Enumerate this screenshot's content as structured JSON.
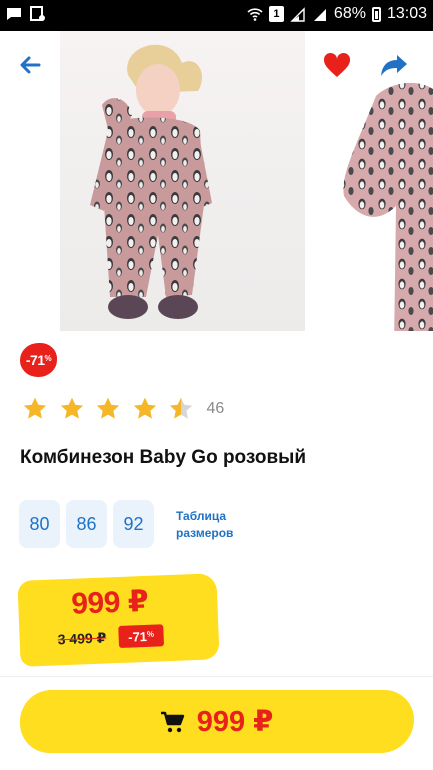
{
  "status_bar": {
    "battery": "68%",
    "time": "13:03",
    "sim_label": "1"
  },
  "product": {
    "discount_badge": "-71",
    "discount_suffix": "%",
    "rating": 4.5,
    "review_count": "46",
    "title": "Комбинезон Baby Go розовый",
    "sizes": [
      "80",
      "86",
      "92"
    ],
    "size_table_link": "Таблица размеров",
    "price": "999 ₽",
    "old_price": "3 499 ₽",
    "old_price_discount": "-71",
    "old_price_discount_suffix": "%",
    "buy_button_label": "999 ₽"
  },
  "colors": {
    "accent_red": "#e8211b",
    "price_yellow": "#ffdd1f",
    "link_blue": "#1f72c4",
    "star_yellow": "#f5b727"
  },
  "icons": {
    "back": "arrow-left-icon",
    "favorite": "heart-icon",
    "share": "share-arrow-icon",
    "cart": "cart-icon"
  }
}
